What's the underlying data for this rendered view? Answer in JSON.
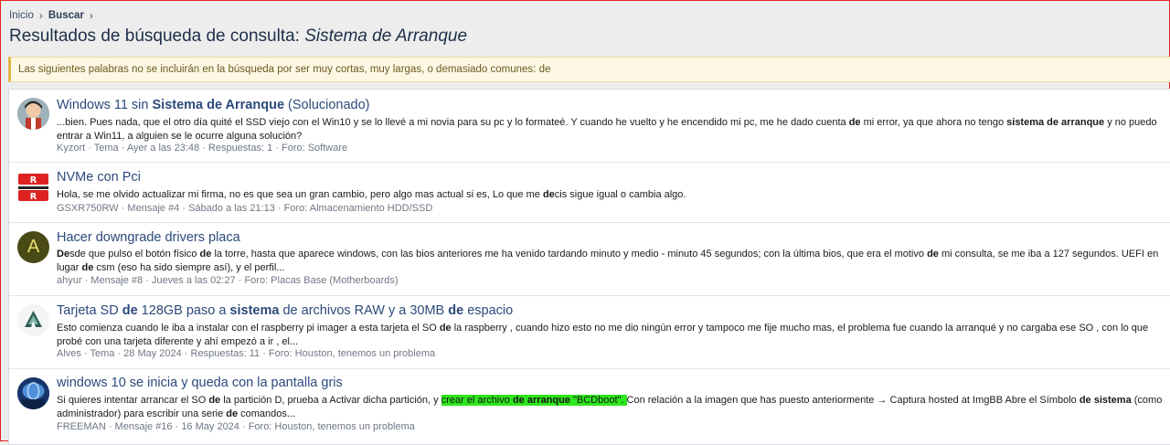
{
  "breadcrumb": {
    "home": "Inicio",
    "current": "Buscar"
  },
  "page_title": {
    "prefix": "Resultados de búsqueda de consulta:",
    "query": "Sistema de Arranque"
  },
  "notice": "Las siguientes palabras no se incluirán en la búsqueda por ser muy cortas, muy largas, o demasiado comunes: de",
  "colors": {
    "accent": "#2b4a7a",
    "notice_bg": "#fdf8e4",
    "highlight": "#2ee61d",
    "window_border": "#e32020"
  },
  "results": [
    {
      "title_a": "Windows 11 sin ",
      "title_b": "Sistema de Arranque",
      "title_c": " (Solucionado)",
      "snip_a": "...bien. Pues nada, que el otro día quité el SSD viejo con el Win10 y se lo llevé a mi novia para su pc y lo formateé. Y cuando he vuelto y he encendido mi pc, me he dado cuenta ",
      "snip_b": "de",
      "snip_c": " mi error, ya que ahora no tengo ",
      "snip_d": "sistema de arranque",
      "snip_e": " y no puedo entrar a Win11, a alguien se le ocurre alguna solución?",
      "meta": "Kyzort · Tema · Ayer a las 23:48 · Respuestas: 1 · Foro: Software",
      "avatar_icon": "cartoon-character-avatar"
    },
    {
      "title": "NVMe con Pci",
      "snip_a": "Hola, se me olvido actualizar mi firma, no es que sea un gran cambio, pero algo mas actual si es, Lo que me ",
      "snip_b": "de",
      "snip_c": "cis sigue igual o cambia algo.",
      "meta": "GSXR750RW · Mensaje #4 · Sábado a las 21:13 · Foro: Almacenamiento HDD/SSD",
      "avatar_icon": "gsxr-logo-avatar"
    },
    {
      "title": "Hacer downgrade drivers placa",
      "snip_a": "De",
      "snip_b": "sde que pulso el botón físico ",
      "snip_c": "de",
      "snip_d": " la torre, hasta que aparece windows, con las bios anteriores me ha venido tardando minuto y medio - minuto 45 segundos; con la última bios, que era el motivo ",
      "snip_e": "de",
      "snip_f": " mi consulta, se me iba a 127 segundos. UEFI en lugar ",
      "snip_g": "de",
      "snip_h": " csm (eso ha sido siempre así), y el perfil...",
      "meta": "ahyur · Mensaje #8 · Jueves a las 02:27 · Foro: Placas Base (Motherboards)",
      "avatar_letter": "A",
      "avatar_color": "#4a4a16"
    },
    {
      "title_a": "Tarjeta SD ",
      "title_b": "de",
      "title_c": " 128GB paso a ",
      "title_d": "sistema",
      "title_e": " de",
      "title_f": " archivos RAW y a 30MB ",
      "title_g": "de",
      "title_h": " espacio",
      "snip_a": "Esto comienza cuando le iba a instalar con el raspberry pi imager a esta tarjeta el SO ",
      "snip_b": "de",
      "snip_c": " la raspberry , cuando hizo esto no me dio ningún error y tampoco me fije mucho mas, el problema fue cuando la arranqué y no cargaba ese SO , con lo que probé con una tarjeta diferente y ahí empezó a ir , el...",
      "meta": "Alves · Tema · 28 May 2024 · Respuestas: 11 · Foro: Houston, tenemos un problema",
      "avatar_icon": "triangle-logo-avatar"
    },
    {
      "title": "windows 10 se inicia y queda con la pantalla gris",
      "snip_a": "Si quieres intentar arrancar el SO ",
      "snip_b": "de",
      "snip_c": " la partición D, prueba a Activar dicha partición, y ",
      "hl_a": "crear el archivo ",
      "hl_b": "de arranque",
      "hl_c": " \"BCDboot\". ",
      "snip_d": "Con relación a la imagen que has puesto anteriormente → Captura hosted at ImgBB Abre el Símbolo ",
      "snip_e": "de sistema",
      "snip_f": " (como administrador) para escribir una serie ",
      "snip_g": "de",
      "snip_h": " comandos...",
      "meta": "FREEMAN · Mensaje #16 · 16 May 2024 · Foro: Houston, tenemos un problema",
      "avatar_icon": "blue-globe-avatar"
    }
  ]
}
